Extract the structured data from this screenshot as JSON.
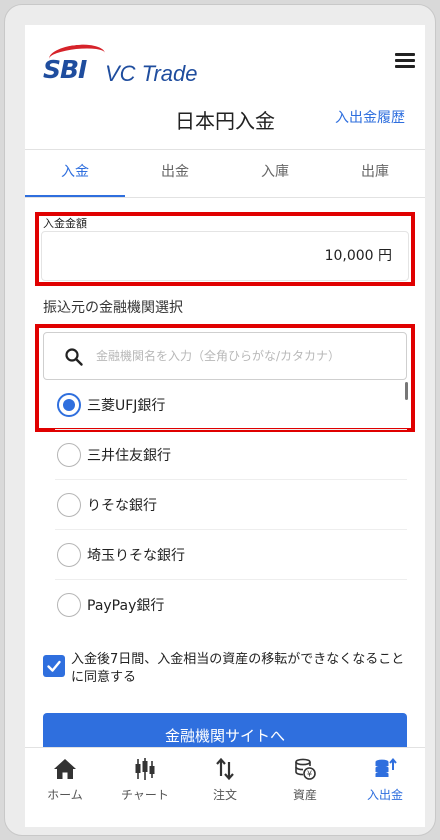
{
  "header": {
    "logo_brand": "SBI",
    "logo_product": "VC Trade",
    "page_title": "日本円入金",
    "history_link": "入出金履歴"
  },
  "tabs": [
    {
      "label": "入金",
      "active": true
    },
    {
      "label": "出金",
      "active": false
    },
    {
      "label": "入庫",
      "active": false
    },
    {
      "label": "出庫",
      "active": false
    }
  ],
  "amount": {
    "label": "入金金額",
    "value": "10,000 円"
  },
  "bank_section": {
    "label": "振込元の金融機関選択",
    "search_placeholder": "金融機関名を入力（全角ひらがな/カタカナ）",
    "banks": [
      {
        "name": "三菱UFJ銀行",
        "selected": true
      },
      {
        "name": "三井住友銀行",
        "selected": false
      },
      {
        "name": "りそな銀行",
        "selected": false
      },
      {
        "name": "埼玉りそな銀行",
        "selected": false
      },
      {
        "name": "PayPay銀行",
        "selected": false
      }
    ]
  },
  "consent": {
    "checked": true,
    "text": "入金後7日間、入金相当の資産の移転ができなくなることに同意する"
  },
  "primary_button": "金融機関サイトへ",
  "bottom_nav": [
    {
      "label": "ホーム",
      "icon": "home-icon",
      "active": false
    },
    {
      "label": "チャート",
      "icon": "chart-icon",
      "active": false
    },
    {
      "label": "注文",
      "icon": "order-icon",
      "active": false
    },
    {
      "label": "資産",
      "icon": "assets-icon",
      "active": false
    },
    {
      "label": "入出金",
      "icon": "deposit-withdraw-icon",
      "active": true
    }
  ],
  "colors": {
    "accent": "#2f6fde",
    "highlight_box": "#e00000",
    "brand_blue": "#1f4d9e",
    "brand_red": "#d6232a"
  }
}
